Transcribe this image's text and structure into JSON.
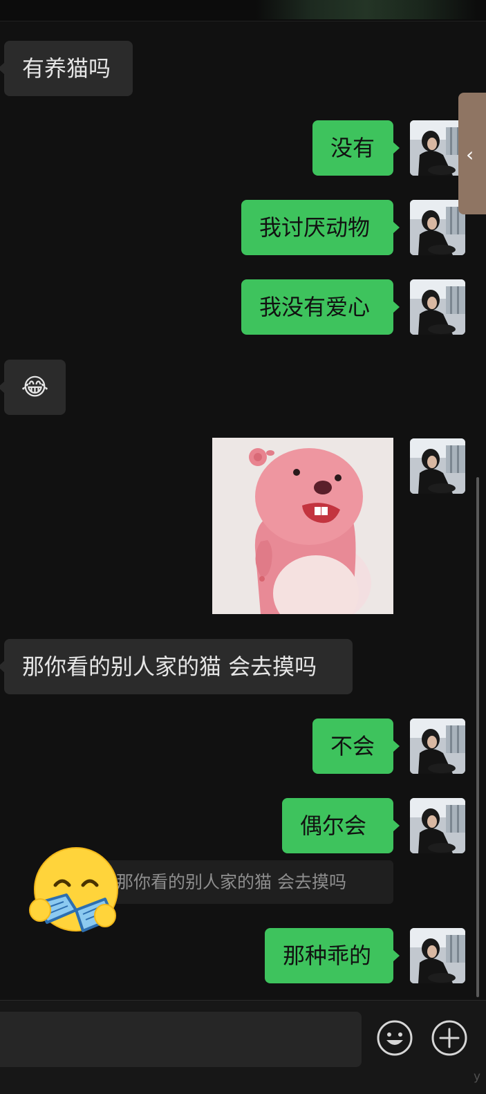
{
  "messages": {
    "m1": "有养猫吗",
    "m2": "没有",
    "m3": "我讨厌动物",
    "m4": "我没有爱心",
    "m5_emoji": "😂",
    "m6_sticker": "pink-beaver-sticker",
    "m7": "那你看的别人家的猫 会去摸吗",
    "m8": "不会",
    "m9": "偶尔会",
    "m9_quote": "那你看的别人家的猫 会去摸吗",
    "m10": "那种乖的"
  },
  "colors": {
    "background": "#111111",
    "incoming_bubble": "#2b2b2b",
    "outgoing_bubble": "#3ec35d",
    "side_tab": "#8f7563"
  },
  "icons": {
    "side_tab": "chevron-left-icon",
    "emoji_button": "smiley-icon",
    "more_button": "plus-circle-icon",
    "overlay_sticker": "reading-emoji-sticker"
  },
  "watermark": "y"
}
